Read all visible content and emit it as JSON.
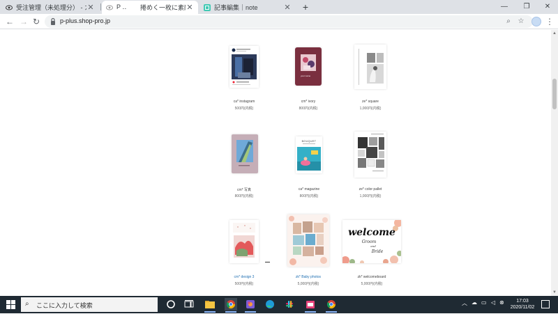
{
  "browser": {
    "tabs": [
      {
        "title": "受注管理（未処理分） - カラーミ‥",
        "active": false
      },
      {
        "title": "P ‥",
        "active": true
      },
      {
        "title": "捲めく一枚に素敵さ",
        "active": false
      },
      {
        "title": "記事編集｜note",
        "active": false
      }
    ],
    "new_tab_label": "+",
    "url": "p-plus.shop-pro.jp",
    "window_controls": [
      "—",
      "❐",
      "✕"
    ]
  },
  "products": [
    {
      "name": "ca* instagram",
      "price": "500円(内税)",
      "link": false
    },
    {
      "name": "cm* ivory",
      "price": "800円(内税)",
      "link": false
    },
    {
      "name": "ze* square",
      "price": "1,000円(内税)",
      "link": false
    },
    {
      "name": "cm* 写真",
      "price": "800円(内税)",
      "link": false
    },
    {
      "name": "ca* magazine",
      "price": "800円(内税)",
      "link": false
    },
    {
      "name": "ze* color pallet",
      "price": "1,000円(内税)",
      "link": false
    },
    {
      "name": "cm* design 3",
      "price": "500円(内税)",
      "link": true
    },
    {
      "name": "zk* Baby photos",
      "price": "5,000円(内税)",
      "link": true
    },
    {
      "name": "zk* welcomeboard",
      "price": "5,000円(内税)",
      "link": false
    }
  ],
  "image_text": {
    "ivory_caption": "your name",
    "magazine_title": "BOUQUET",
    "welcome_title": "welcome",
    "welcome_sub": "Groom",
    "welcome_and": "and",
    "welcome_bride": "Bride"
  },
  "taskbar": {
    "search_placeholder": "ここに入力して検索",
    "time": "17:03",
    "date": "2020/11/02"
  },
  "colors": {
    "tabstrip_bg": "#dee1e6",
    "taskbar_bg": "#1f2a33",
    "link": "#1f6fb2"
  }
}
